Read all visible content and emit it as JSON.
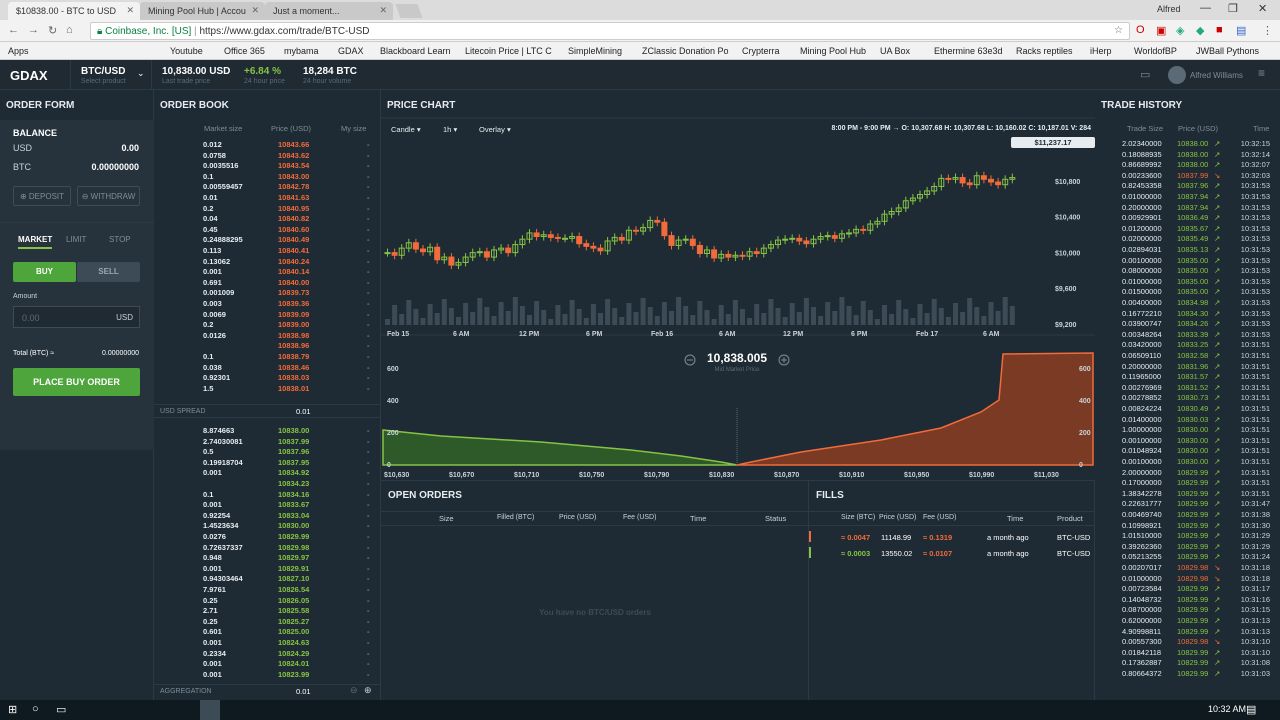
{
  "browser": {
    "tabs": [
      {
        "label": "$10838.00 - BTC to USD",
        "active": true
      },
      {
        "label": "Mining Pool Hub | Accou",
        "active": false
      },
      {
        "label": "Just a moment...",
        "active": false
      }
    ],
    "user": "Alfred",
    "security_label": "Coinbase, Inc. [US]",
    "url": "https://www.gdax.com/trade/BTC-USD",
    "bookmarks": [
      "Apps",
      "Youtube",
      "Office 365",
      "mybama",
      "GDAX",
      "Blackboard Learn",
      "Litecoin Price | LTC C",
      "SimpleMining",
      "ZClassic Donation Po",
      "Crypterra",
      "Mining Pool Hub",
      "UA Box",
      "Ethermine 63e3d",
      "Racks reptiles",
      "iHerp",
      "WorldofBP",
      "JWBall Pythons"
    ]
  },
  "header": {
    "logo": "GDAX",
    "product": "BTC/USD",
    "product_sub": "Select product",
    "last_price": "10,838.00 USD",
    "last_price_sub": "Last trade price",
    "change": "+6.84 %",
    "change_sub": "24 hour price",
    "volume": "18,284 BTC",
    "volume_sub": "24 hour volume",
    "username": "Alfred Williams"
  },
  "order_form": {
    "title": "ORDER FORM",
    "balance_title": "BALANCE",
    "usd_label": "USD",
    "usd_value": "0.00",
    "btc_label": "BTC",
    "btc_value": "0.00000000",
    "deposit": "DEPOSIT",
    "withdraw": "WITHDRAW",
    "tabs": [
      "MARKET",
      "LIMIT",
      "STOP"
    ],
    "buy": "BUY",
    "sell": "SELL",
    "amount_label": "Amount",
    "amount_placeholder": "0.00",
    "amount_unit": "USD",
    "total_label": "Total (BTC) ≈",
    "total_value": "0.00000000",
    "place_order": "PLACE BUY ORDER"
  },
  "order_book": {
    "title": "ORDER BOOK",
    "col_market_size": "Market size",
    "col_price": "Price (USD)",
    "col_my_size": "My size",
    "asks": [
      [
        "0.012",
        "10843.66"
      ],
      [
        "0.0758",
        "10843.62"
      ],
      [
        "0.0035516",
        "10843.54"
      ],
      [
        "0.1",
        "10843.00"
      ],
      [
        "0.00559457",
        "10842.78"
      ],
      [
        "0.01",
        "10841.63"
      ],
      [
        "0.2",
        "10840.95"
      ],
      [
        "0.04",
        "10840.82"
      ],
      [
        "0.45",
        "10840.60"
      ],
      [
        "0.24888295",
        "10840.49"
      ],
      [
        "0.113",
        "10840.41"
      ],
      [
        "0.13062",
        "10840.24"
      ],
      [
        "0.001",
        "10840.14"
      ],
      [
        "0.691",
        "10840.00"
      ],
      [
        "0.001009",
        "10839.73"
      ],
      [
        "0.003",
        "10839.36"
      ],
      [
        "0.0069",
        "10839.09"
      ],
      [
        "0.2",
        "10839.00"
      ],
      [
        "0.0126",
        "10838.98"
      ],
      [
        "",
        "10838.96"
      ],
      [
        "0.1",
        "10838.79"
      ],
      [
        "0.038",
        "10838.46"
      ],
      [
        "0.92301",
        "10838.03"
      ],
      [
        "1.5",
        "10838.01"
      ]
    ],
    "spread_label": "USD SPREAD",
    "spread_value": "0.01",
    "bids": [
      [
        "8.874663",
        "10838.00"
      ],
      [
        "2.74030081",
        "10837.99"
      ],
      [
        "0.5",
        "10837.96"
      ],
      [
        "0.19918704",
        "10837.95"
      ],
      [
        "0.001",
        "10834.92"
      ],
      [
        "",
        "10834.23"
      ],
      [
        "0.1",
        "10834.16"
      ],
      [
        "0.001",
        "10833.67"
      ],
      [
        "0.92254",
        "10833.04"
      ],
      [
        "1.4523634",
        "10830.00"
      ],
      [
        "0.0276",
        "10829.99"
      ],
      [
        "0.72637337",
        "10829.98"
      ],
      [
        "0.948",
        "10829.97"
      ],
      [
        "0.001",
        "10829.91"
      ],
      [
        "0.94303464",
        "10827.10"
      ],
      [
        "7.9761",
        "10826.54"
      ],
      [
        "0.25",
        "10826.05"
      ],
      [
        "2.71",
        "10825.58"
      ],
      [
        "0.25",
        "10825.27"
      ],
      [
        "0.601",
        "10825.00"
      ],
      [
        "0.001",
        "10824.63"
      ],
      [
        "0.2334",
        "10824.29"
      ],
      [
        "0.001",
        "10824.01"
      ],
      [
        "0.001",
        "10823.99"
      ]
    ],
    "aggregation_label": "AGGREGATION",
    "aggregation_value": "0.01"
  },
  "price_chart": {
    "title": "PRICE CHART",
    "candle_label": "Candle",
    "interval": "1h",
    "overlay": "Overlay",
    "ohlc": "8:00 PM - 9:00 PM → O: 10,307.68  H: 10,307.68  L: 10,160.02  C: 10,187.01  V: 284",
    "top_price": "$11,237.17",
    "y_ticks": [
      "$10,800",
      "$10,400",
      "$10,000",
      "$9,600",
      "$9,200"
    ],
    "x_ticks": [
      "Feb 15",
      "6 AM",
      "12 PM",
      "6 PM",
      "Feb 16",
      "6 AM",
      "12 PM",
      "6 PM",
      "Feb 17",
      "6 AM"
    ]
  },
  "depth": {
    "mid_price": "10,838.005",
    "mid_label": "Mid Market Price",
    "y_ticks": [
      "600",
      "400",
      "200",
      "0"
    ],
    "x_ticks": [
      "$10,630",
      "$10,670",
      "$10,710",
      "$10,750",
      "$10,790",
      "$10,830",
      "$10,870",
      "$10,910",
      "$10,950",
      "$10,990",
      "$11,030"
    ]
  },
  "open_orders": {
    "title": "OPEN ORDERS",
    "cols": [
      "Size",
      "Filled (BTC)",
      "Price (USD)",
      "Fee (USD)",
      "Time",
      "Status"
    ],
    "empty": "You have no BTC/USD orders"
  },
  "fills": {
    "title": "FILLS",
    "cols": [
      "Size (BTC)",
      "Price (USD)",
      "Fee (USD)",
      "Time",
      "Product"
    ],
    "rows": [
      {
        "size": "≈ 0.0047",
        "price": "11148.99",
        "fee": "≈ 0.1319",
        "time": "a month ago",
        "product": "BTC-USD",
        "side": "sell"
      },
      {
        "size": "≈ 0.0003",
        "price": "13550.02",
        "fee": "≈ 0.0107",
        "time": "a month ago",
        "product": "BTC-USD",
        "side": "buy"
      }
    ]
  },
  "trade_history": {
    "title": "TRADE HISTORY",
    "col_size": "Trade Size",
    "col_price": "Price (USD)",
    "col_time": "Time",
    "rows": [
      [
        "2.02340000",
        "10838.00",
        "10:32:15",
        "g"
      ],
      [
        "0.18088935",
        "10838.00",
        "10:32:14",
        "g"
      ],
      [
        "0.86689992",
        "10838.00",
        "10:32:07",
        "g"
      ],
      [
        "0.00233600",
        "10837.99",
        "10:32:03",
        "r"
      ],
      [
        "0.82453358",
        "10837.96",
        "10:31:53",
        "g"
      ],
      [
        "0.01000000",
        "10837.94",
        "10:31:53",
        "g"
      ],
      [
        "0.20000000",
        "10837.94",
        "10:31:53",
        "g"
      ],
      [
        "0.00929901",
        "10836.49",
        "10:31:53",
        "g"
      ],
      [
        "0.01200000",
        "10835.67",
        "10:31:53",
        "g"
      ],
      [
        "0.02000000",
        "10835.49",
        "10:31:53",
        "g"
      ],
      [
        "0.02894031",
        "10835.13",
        "10:31:53",
        "g"
      ],
      [
        "0.00100000",
        "10835.00",
        "10:31:53",
        "g"
      ],
      [
        "0.08000000",
        "10835.00",
        "10:31:53",
        "g"
      ],
      [
        "0.01000000",
        "10835.00",
        "10:31:53",
        "g"
      ],
      [
        "0.01500000",
        "10835.00",
        "10:31:53",
        "g"
      ],
      [
        "0.00400000",
        "10834.98",
        "10:31:53",
        "g"
      ],
      [
        "0.16772210",
        "10834.30",
        "10:31:53",
        "g"
      ],
      [
        "0.03900747",
        "10834.26",
        "10:31:53",
        "g"
      ],
      [
        "0.00348264",
        "10833.39",
        "10:31:53",
        "g"
      ],
      [
        "0.03420000",
        "10833.25",
        "10:31:51",
        "g"
      ],
      [
        "0.06509110",
        "10832.58",
        "10:31:51",
        "g"
      ],
      [
        "0.20000000",
        "10831.96",
        "10:31:51",
        "g"
      ],
      [
        "0.11965000",
        "10831.57",
        "10:31:51",
        "g"
      ],
      [
        "0.00276969",
        "10831.52",
        "10:31:51",
        "g"
      ],
      [
        "0.00278852",
        "10830.73",
        "10:31:51",
        "g"
      ],
      [
        "0.00824224",
        "10830.49",
        "10:31:51",
        "g"
      ],
      [
        "0.01400000",
        "10830.03",
        "10:31:51",
        "g"
      ],
      [
        "1.00000000",
        "10830.00",
        "10:31:51",
        "g"
      ],
      [
        "0.00100000",
        "10830.00",
        "10:31:51",
        "g"
      ],
      [
        "0.01048924",
        "10830.00",
        "10:31:51",
        "g"
      ],
      [
        "0.00100000",
        "10830.00",
        "10:31:51",
        "g"
      ],
      [
        "2.00000000",
        "10829.99",
        "10:31:51",
        "g"
      ],
      [
        "0.17000000",
        "10829.99",
        "10:31:51",
        "g"
      ],
      [
        "1.38342278",
        "10829.99",
        "10:31:51",
        "g"
      ],
      [
        "0.22631777",
        "10829.99",
        "10:31:47",
        "g"
      ],
      [
        "0.00469740",
        "10829.99",
        "10:31:38",
        "g"
      ],
      [
        "0.10998921",
        "10829.99",
        "10:31:30",
        "g"
      ],
      [
        "1.01510000",
        "10829.99",
        "10:31:29",
        "g"
      ],
      [
        "0.39262360",
        "10829.99",
        "10:31:29",
        "g"
      ],
      [
        "0.05213255",
        "10829.99",
        "10:31:24",
        "g"
      ],
      [
        "0.00207017",
        "10829.98",
        "10:31:18",
        "r"
      ],
      [
        "0.01000000",
        "10829.98",
        "10:31:18",
        "r"
      ],
      [
        "0.00723584",
        "10829.99",
        "10:31:17",
        "g"
      ],
      [
        "0.14048732",
        "10829.99",
        "10:31:16",
        "g"
      ],
      [
        "0.08700000",
        "10829.99",
        "10:31:15",
        "g"
      ],
      [
        "0.62000000",
        "10829.99",
        "10:31:13",
        "g"
      ],
      [
        "4.90998811",
        "10829.99",
        "10:31:13",
        "g"
      ],
      [
        "0.00557300",
        "10829.98",
        "10:31:10",
        "r"
      ],
      [
        "0.01842118",
        "10829.99",
        "10:31:10",
        "g"
      ],
      [
        "0.17362887",
        "10829.99",
        "10:31:08",
        "g"
      ],
      [
        "0.80664372",
        "10829.99",
        "10:31:03",
        "g"
      ]
    ]
  },
  "taskbar": {
    "time": "10:32 AM"
  },
  "colors": {
    "green": "#86c344",
    "red": "#f26b3a",
    "bg": "#1e2b34"
  }
}
